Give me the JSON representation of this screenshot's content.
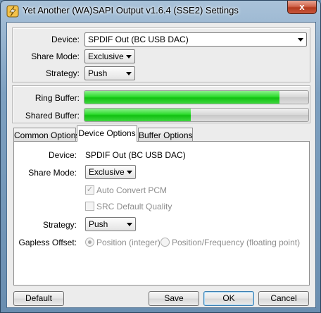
{
  "window": {
    "title": "Yet Another (WA)SAPI Output v1.6.4 (SSE2) Settings",
    "close_glyph": "x"
  },
  "top": {
    "device_label": "Device:",
    "device_value": "SPDIF Out (BC USB DAC)",
    "share_mode_label": "Share Mode:",
    "share_mode_value": "Exclusive",
    "strategy_label": "Strategy:",
    "strategy_value": "Push"
  },
  "buffers": {
    "ring_label": "Ring Buffer:",
    "ring_fill": 0.87,
    "shared_label": "Shared Buffer:",
    "shared_fill": 0.475,
    "fill_color": "#21d221"
  },
  "tabs": [
    {
      "label": "Common Options"
    },
    {
      "label": "Device Options"
    },
    {
      "label": "Buffer Options"
    }
  ],
  "device_tab": {
    "device_label": "Device:",
    "device_value": "SPDIF Out (BC USB DAC)",
    "share_mode_label": "Share Mode:",
    "share_mode_value": "Exclusive",
    "auto_convert_label": "Auto Convert PCM",
    "src_quality_label": "SRC Default Quality",
    "strategy_label": "Strategy:",
    "strategy_value": "Push",
    "gapless_label": "Gapless Offset:",
    "gapless_opt1": "Position (integer)",
    "gapless_opt2": "Position/Frequency (floating point)"
  },
  "buttons": {
    "default": "Default",
    "save": "Save",
    "ok": "OK",
    "cancel": "Cancel"
  }
}
